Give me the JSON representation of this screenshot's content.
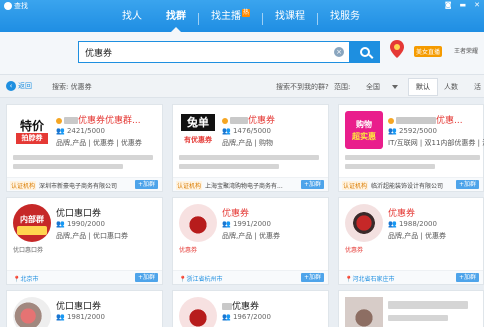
{
  "app": {
    "title": "查找"
  },
  "nav": {
    "items": [
      "找人",
      "找群",
      "找主播",
      "找课程",
      "找服务"
    ],
    "hot_badge": "热"
  },
  "search": {
    "value": "优惠券"
  },
  "header_right": {
    "badge": "美女直播",
    "user": "王者荣耀"
  },
  "filter": {
    "back": "返回",
    "search_label": "搜索: 优惠券",
    "not_found": "搜索不到我的群?",
    "range_label": "范围:",
    "range_value": "全国",
    "sort_default": "默认",
    "sort_people": "人数",
    "sort_active": "活"
  },
  "cards": [
    {
      "avatar_line1": "特价",
      "avatar_line2": "拍脖券",
      "name": "优惠券优惠群...",
      "members": "2421/5000",
      "tags": "品牌,产品 | 优惠券 | 优惠券",
      "cert": "认证机构",
      "company": "深圳市新豪电子商务有限公司",
      "join": "+加群"
    },
    {
      "avatar_line1": "兔单",
      "avatar_line2": "有优惠券",
      "name": "优惠券",
      "members": "1476/5000",
      "tags": "品牌,产品 | 购物",
      "cert": "认证机构",
      "company": "上海宝聚湾购物电子商务有...",
      "join": "+加群"
    },
    {
      "avatar_line1": "购物",
      "avatar_line2": "超实惠",
      "name": "优惠...",
      "members": "2592/5000",
      "tags": "IT/互联网 | 双11内部优惠券 | 淘",
      "cert": "认证机构",
      "company": "临沂超能装饰设计有限公司",
      "join": "+加群"
    },
    {
      "avatar_line1": "内部群",
      "name": "优口惠口券",
      "members": "1990/2000",
      "tags": "品牌,产品 | 优口惠口券",
      "desc": "优口惠口券",
      "location": "北京市",
      "join": "+加群"
    },
    {
      "name": "优惠券",
      "members": "1991/2000",
      "tags": "品牌,产品 | 优惠券",
      "desc": "优惠券",
      "location": "浙江省杭州市",
      "join": "+加群"
    },
    {
      "name": "优惠券",
      "members": "1988/2000",
      "tags": "品牌,产品 | 优惠券",
      "desc": "优惠券",
      "location": "河北省石家庄市",
      "join": "+加群"
    },
    {
      "name": "优口惠口券",
      "members": "1981/2000"
    },
    {
      "name": "优惠券",
      "members": "1967/2000"
    }
  ]
}
